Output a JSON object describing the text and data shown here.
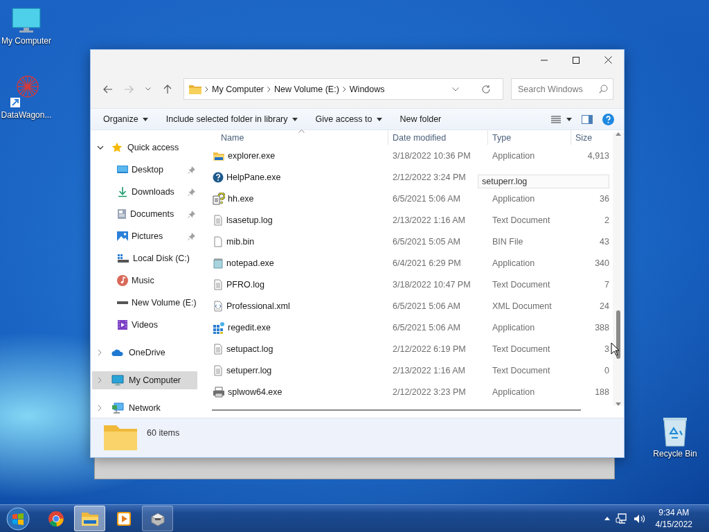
{
  "desktop": {
    "icons": [
      {
        "label": "My Computer",
        "kind": "computer"
      },
      {
        "label": "DataWagon...",
        "kind": "shortcut"
      },
      {
        "label": "Recycle Bin",
        "kind": "recycle"
      }
    ]
  },
  "window": {
    "address": {
      "crumbs": [
        "My Computer",
        "New Volume (E:)",
        "Windows"
      ]
    },
    "search": {
      "placeholder": "Search Windows"
    },
    "toolbar": [
      {
        "label": "Organize",
        "dropdown": true
      },
      {
        "label": "Include selected folder in library",
        "dropdown": true
      },
      {
        "label": "Give access to",
        "dropdown": true
      },
      {
        "label": "New folder",
        "dropdown": false
      }
    ],
    "nav": [
      {
        "label": "Quick access",
        "kind": "star",
        "expanded": true,
        "selected": false,
        "children": [
          {
            "label": "Desktop",
            "kind": "desktop",
            "pinned": true,
            "selected": false
          },
          {
            "label": "Downloads",
            "kind": "download",
            "pinned": true,
            "selected": false
          },
          {
            "label": "Documents",
            "kind": "documents",
            "pinned": true,
            "selected": false
          },
          {
            "label": "Pictures",
            "kind": "pictures",
            "pinned": true,
            "selected": false
          },
          {
            "label": "Local Disk (C:)",
            "kind": "system-drive",
            "pinned": false,
            "selected": false
          },
          {
            "label": "Music",
            "kind": "music",
            "pinned": false,
            "selected": false
          },
          {
            "label": "New Volume (E:)",
            "kind": "drive",
            "pinned": false,
            "selected": false
          },
          {
            "label": "Videos",
            "kind": "videos",
            "pinned": false,
            "selected": false
          }
        ]
      },
      {
        "label": "OneDrive",
        "kind": "cloud",
        "expanded": false,
        "selected": false
      },
      {
        "label": "My Computer",
        "kind": "computer",
        "expanded": false,
        "selected": true
      },
      {
        "label": "Network",
        "kind": "network",
        "expanded": false,
        "selected": false
      }
    ],
    "columns": [
      {
        "label": "Name",
        "sorted": true
      },
      {
        "label": "Date modified",
        "sorted": false
      },
      {
        "label": "Type",
        "sorted": false
      },
      {
        "label": "Size",
        "sorted": false
      }
    ],
    "rows": [
      {
        "name": "explorer.exe",
        "kind": "explorer",
        "date": "3/18/2022 10:36 PM",
        "type": "Application",
        "size": "4,913",
        "selected": false
      },
      {
        "name": "HelpPane.exe",
        "kind": "help",
        "date": "2/12/2022 3:24 PM",
        "selected": false
      },
      {
        "name": "hh.exe",
        "kind": "help-doc",
        "date": "6/5/2021 5:06 AM",
        "type": "Application",
        "size": "36",
        "selected": false
      },
      {
        "name": "lsasetup.log",
        "kind": "text",
        "date": "2/13/2022 1:16 AM",
        "type": "Text Document",
        "size": "2",
        "selected": false
      },
      {
        "name": "mib.bin",
        "kind": "blank",
        "date": "6/5/2021 5:05 AM",
        "type": "BIN File",
        "size": "43",
        "selected": false
      },
      {
        "name": "notepad.exe",
        "kind": "notepad",
        "date": "6/4/2021 6:29 PM",
        "type": "Application",
        "size": "340",
        "selected": false
      },
      {
        "name": "PFRO.log",
        "kind": "text",
        "date": "3/18/2022 10:47 PM",
        "type": "Text Document",
        "size": "7",
        "selected": false
      },
      {
        "name": "Professional.xml",
        "kind": "xml",
        "date": "6/5/2021 5:06 AM",
        "type": "XML Document",
        "size": "24",
        "selected": false
      },
      {
        "name": "regedit.exe",
        "kind": "registry",
        "date": "6/5/2021 5:06 AM",
        "type": "Application",
        "size": "388",
        "selected": false
      },
      {
        "name": "setupact.log",
        "kind": "text",
        "date": "2/12/2022 6:19 PM",
        "type": "Text Document",
        "size": "3",
        "selected": false
      },
      {
        "name": "setuperr.log",
        "kind": "text",
        "date": "2/13/2022 1:16 AM",
        "type": "Text Document",
        "size": "0",
        "selected": false
      },
      {
        "name": "splwow64.exe",
        "kind": "printer",
        "date": "2/12/2022 3:23 PM",
        "type": "Application",
        "size": "188",
        "selected": false
      }
    ],
    "tooltip": {
      "text": "setuperr.log"
    },
    "status": {
      "item_count": "60 items"
    }
  },
  "taskbar": {
    "apps": [
      {
        "kind": "start",
        "open": false,
        "selected": false
      },
      {
        "kind": "browser",
        "open": false,
        "selected": false
      },
      {
        "kind": "explorer",
        "open": true,
        "selected": true
      },
      {
        "kind": "media",
        "open": false,
        "selected": false
      },
      {
        "kind": "app",
        "open": true,
        "selected": false
      }
    ],
    "clock": {
      "time": "9:34 AM",
      "date": "4/15/2022"
    }
  }
}
